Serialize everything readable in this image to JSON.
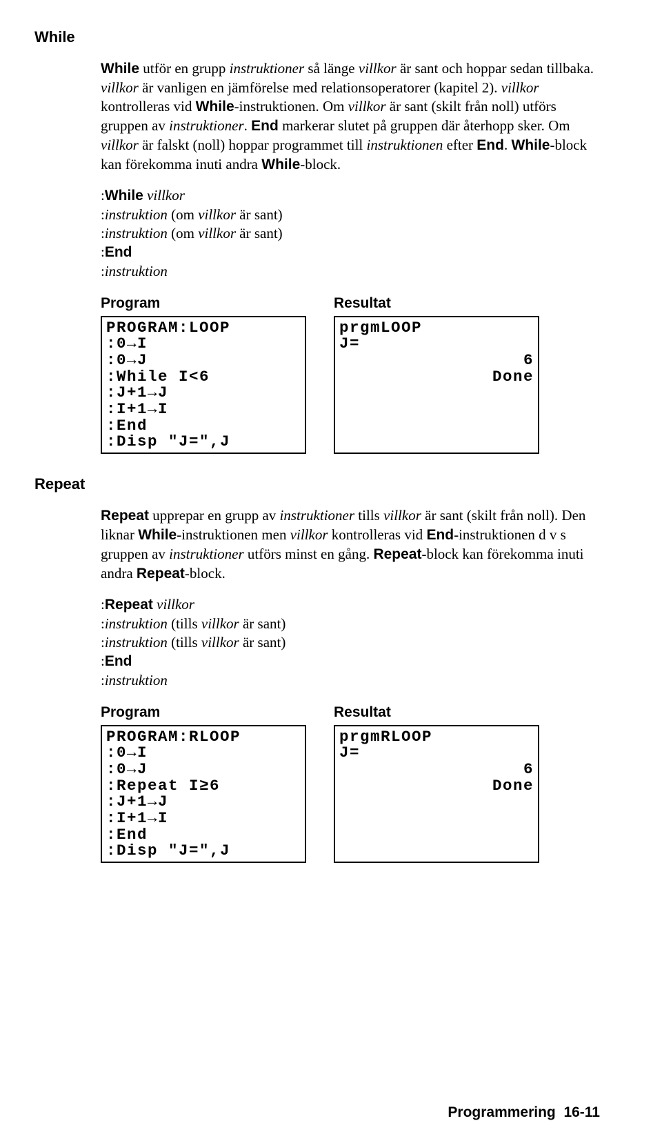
{
  "while": {
    "heading": "While",
    "p1_parts": [
      {
        "b": "While"
      },
      {
        "t": " utför en grupp "
      },
      {
        "i": "instruktioner"
      },
      {
        "t": " så länge "
      },
      {
        "i": "villkor"
      },
      {
        "t": " är sant och hoppar sedan tillbaka. "
      },
      {
        "i": "villkor"
      },
      {
        "t": " är vanligen en jämförelse med relationsoperatorer (kapitel 2). "
      },
      {
        "i": "villkor"
      },
      {
        "t": " kontrolleras vid "
      },
      {
        "b": "While"
      },
      {
        "t": "-instruktionen. Om "
      },
      {
        "i": "villkor"
      },
      {
        "t": " är sant (skilt från noll) utförs gruppen av "
      },
      {
        "i": "instruktioner"
      },
      {
        "t": ". "
      },
      {
        "b": "End"
      },
      {
        "t": " markerar slutet på gruppen där återhopp sker. Om "
      },
      {
        "i": "villkor"
      },
      {
        "t": " är falskt (noll) hoppar programmet till "
      },
      {
        "i": "instruktionen"
      },
      {
        "t": " efter "
      },
      {
        "b": "End"
      },
      {
        "t": ". "
      },
      {
        "b": "While"
      },
      {
        "t": "-block kan förekomma inuti andra "
      },
      {
        "b": "While"
      },
      {
        "t": "-block."
      }
    ],
    "syntax": [
      [
        {
          "t": ":"
        },
        {
          "b": "While"
        },
        {
          "t": " "
        },
        {
          "i": "villkor"
        }
      ],
      [
        {
          "t": ":"
        },
        {
          "i": "instruktion"
        },
        {
          "t": " (om "
        },
        {
          "i": "villkor"
        },
        {
          "t": " är sant)"
        }
      ],
      [
        {
          "t": ":"
        },
        {
          "i": "instruktion"
        },
        {
          "t": " (om "
        },
        {
          "i": "villkor"
        },
        {
          "t": " är sant)"
        }
      ],
      [
        {
          "t": ":"
        },
        {
          "b": "End"
        }
      ],
      [
        {
          "t": ":"
        },
        {
          "i": "instruktion"
        }
      ]
    ],
    "program_label": "Program",
    "result_label": "Resultat",
    "program_screen": "PROGRAM:LOOP\n:0→I\n:0→J\n:While I<6\n:J+1→J\n:I+1→I\n:End\n:Disp \"J=\",J",
    "result_screen": {
      "lines": [
        "prgmLOOP",
        "J="
      ],
      "right": [
        "6",
        "Done"
      ]
    }
  },
  "repeat": {
    "heading": "Repeat",
    "p1_parts": [
      {
        "b": "Repeat"
      },
      {
        "t": " upprepar en grupp av "
      },
      {
        "i": "instruktioner"
      },
      {
        "t": " tills "
      },
      {
        "i": "villkor"
      },
      {
        "t": " är sant (skilt från noll). Den liknar "
      },
      {
        "b": "While"
      },
      {
        "t": "-instruktionen men "
      },
      {
        "i": "villkor"
      },
      {
        "t": " kontrolleras vid "
      },
      {
        "b": "End"
      },
      {
        "t": "-instruktionen d v s gruppen av "
      },
      {
        "i": "instruktioner"
      },
      {
        "t": " utförs minst en gång. "
      },
      {
        "b": "Repeat"
      },
      {
        "t": "-block kan förekomma inuti andra "
      },
      {
        "b": "Repeat"
      },
      {
        "t": "-block."
      }
    ],
    "syntax": [
      [
        {
          "t": ":"
        },
        {
          "b": "Repeat"
        },
        {
          "t": " "
        },
        {
          "i": "villkor"
        }
      ],
      [
        {
          "t": ":"
        },
        {
          "i": "instruktion"
        },
        {
          "t": " (tills "
        },
        {
          "i": "villkor"
        },
        {
          "t": " är sant)"
        }
      ],
      [
        {
          "t": ":"
        },
        {
          "i": "instruktion"
        },
        {
          "t": " (tills "
        },
        {
          "i": "villkor"
        },
        {
          "t": " är sant)"
        }
      ],
      [
        {
          "t": ":"
        },
        {
          "b": "End"
        }
      ],
      [
        {
          "t": ":"
        },
        {
          "i": "instruktion"
        }
      ]
    ],
    "program_label": "Program",
    "result_label": "Resultat",
    "program_screen": "PROGRAM:RLOOP\n:0→I\n:0→J\n:Repeat I≥6\n:J+1→J\n:I+1→I\n:End\n:Disp \"J=\",J",
    "result_screen": {
      "lines": [
        "prgmRLOOP",
        "J="
      ],
      "right": [
        "6",
        "Done"
      ]
    }
  },
  "footer": {
    "chapter": "Programmering",
    "page": "16-11"
  }
}
